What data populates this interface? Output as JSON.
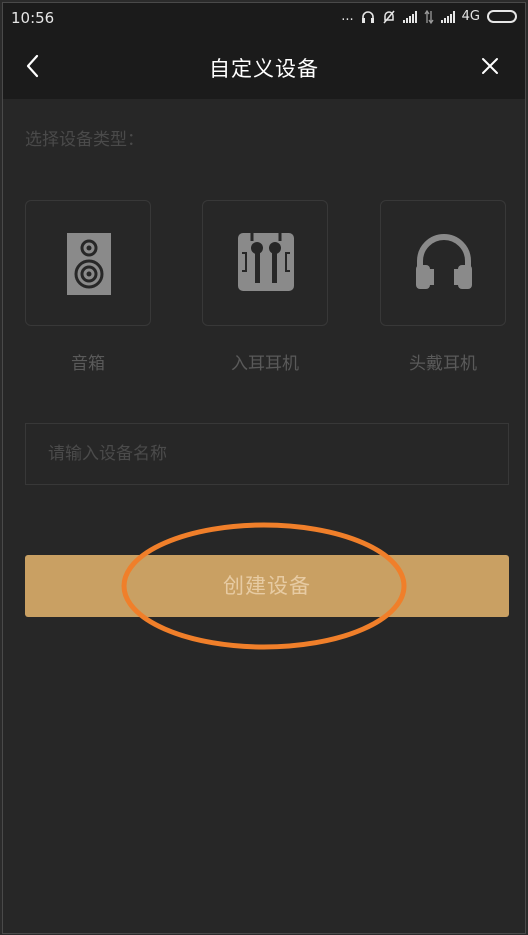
{
  "status_bar": {
    "time": "10:56",
    "dots": "...",
    "network": "4G",
    "icons": [
      "headphone-icon",
      "silent-icon",
      "signal-icon",
      "data-arrows-icon",
      "battery-icon"
    ]
  },
  "nav": {
    "title": "自定义设备",
    "back_icon": "chevron-left-icon",
    "close_icon": "close-icon"
  },
  "device_section": {
    "label": "选择设备类型：",
    "devices": [
      {
        "label": "音箱",
        "icon": "speaker-icon"
      },
      {
        "label": "入耳耳机",
        "icon": "earphones-icon"
      },
      {
        "label": "头戴耳机",
        "icon": "headphones-icon"
      }
    ]
  },
  "name_input": {
    "placeholder": "请输入设备名称",
    "value": ""
  },
  "create_button": {
    "label": "创建设备"
  },
  "colors": {
    "background": "#272727",
    "bar": "#1b1b1b",
    "button": "#c9a063",
    "highlight_ring": "#f07f2a"
  }
}
